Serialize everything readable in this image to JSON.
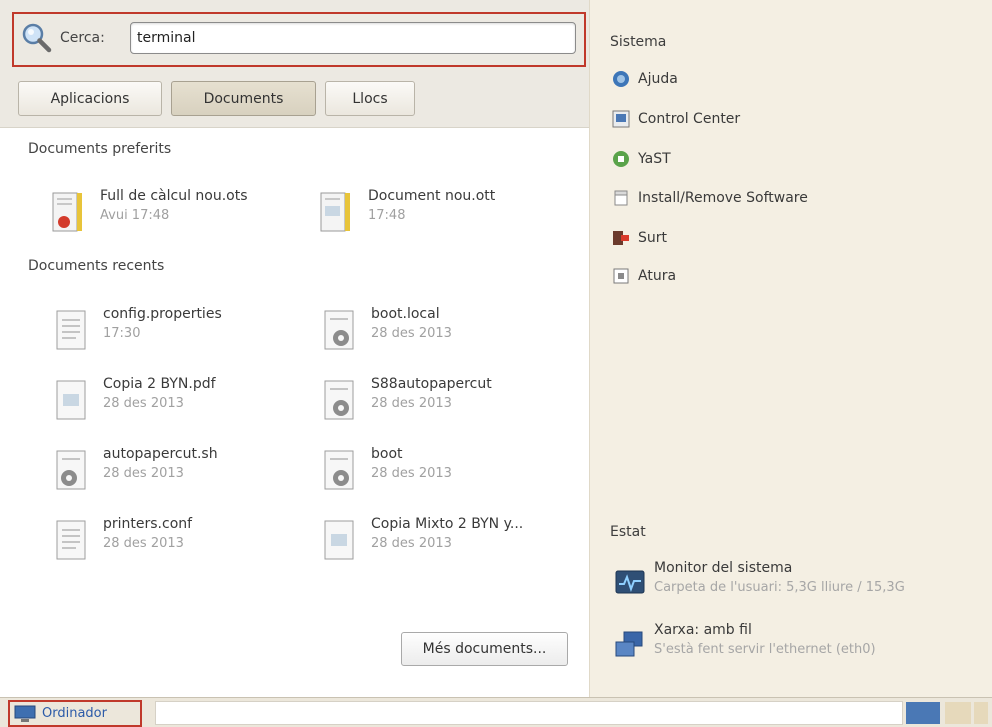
{
  "search": {
    "label": "Cerca:",
    "value": "terminal"
  },
  "tabs": [
    {
      "label": "Aplicacions",
      "active": false
    },
    {
      "label": "Documents",
      "active": true
    },
    {
      "label": "Llocs",
      "active": false
    }
  ],
  "favorites": {
    "title": "Documents preferits",
    "items": [
      {
        "name": "Full de càlcul nou.ots",
        "time": "Avui 17:48",
        "icon": "spreadsheet-template-icon"
      },
      {
        "name": "Document nou.ott",
        "time": "17:48",
        "icon": "text-template-icon"
      }
    ]
  },
  "recent": {
    "title": "Documents recents",
    "items": [
      {
        "name": "config.properties",
        "time": "17:30",
        "icon": "text-file-icon"
      },
      {
        "name": "boot.local",
        "time": "28 des 2013",
        "icon": "script-file-icon"
      },
      {
        "name": "Copia 2 BYN.pdf",
        "time": "28 des 2013",
        "icon": "pdf-file-icon"
      },
      {
        "name": "S88autopapercut",
        "time": "28 des 2013",
        "icon": "script-file-icon"
      },
      {
        "name": "autopapercut.sh",
        "time": "28 des 2013",
        "icon": "script-file-icon"
      },
      {
        "name": "boot",
        "time": "28 des 2013",
        "icon": "script-file-icon"
      },
      {
        "name": "printers.conf",
        "time": "28 des 2013",
        "icon": "text-file-icon"
      },
      {
        "name": "Copia Mixto 2 BYN y...",
        "time": "28 des 2013",
        "icon": "pdf-file-icon"
      }
    ]
  },
  "more_docs_label": "Més documents...",
  "system": {
    "title": "Sistema",
    "items": [
      {
        "label": "Ajuda",
        "icon": "help-icon"
      },
      {
        "label": "Control Center",
        "icon": "control-center-icon"
      },
      {
        "label": "YaST",
        "icon": "yast-icon"
      },
      {
        "label": "Install/Remove Software",
        "icon": "package-icon"
      },
      {
        "label": "Surt",
        "icon": "logout-icon"
      },
      {
        "label": "Atura",
        "icon": "shutdown-icon"
      }
    ]
  },
  "status": {
    "title": "Estat",
    "items": [
      {
        "title": "Monitor del sistema",
        "subtitle": "Carpeta de l'usuari: 5,3G lliure / 15,3G",
        "icon": "system-monitor-icon"
      },
      {
        "title": "Xarxa: amb fil",
        "subtitle": "S'està fent servir l'ethernet (eth0)",
        "icon": "network-wired-icon"
      }
    ]
  },
  "taskbar": {
    "computer_label": "Ordinador"
  },
  "colors": {
    "highlight_border": "#c0392b",
    "accent_blue": "#2b5aa8",
    "panel_bg": "#f4efe3"
  }
}
